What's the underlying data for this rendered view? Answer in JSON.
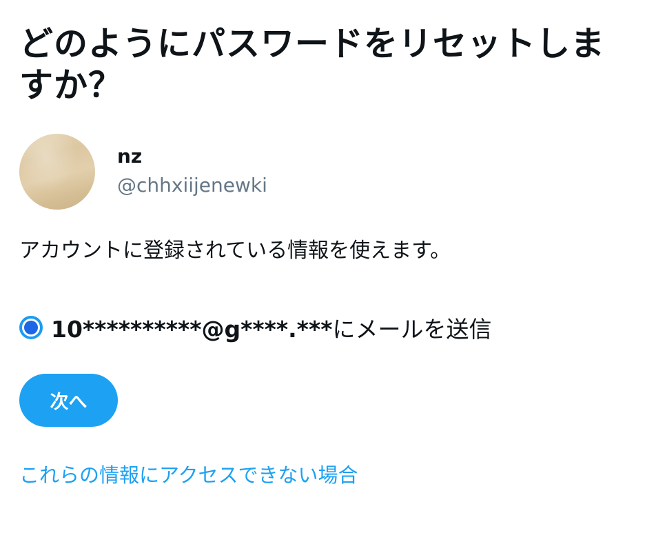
{
  "page": {
    "title": "どのようにパスワードをリセットしますか？"
  },
  "account": {
    "name": "nz",
    "handle": "@chhxiijenewki"
  },
  "description": "アカウントに登録されている情報を使えます。",
  "options": [
    {
      "masked_email": "10**********@g****.***",
      "action_text": "にメールを送信",
      "selected": true
    }
  ],
  "buttons": {
    "next_label": "次へ"
  },
  "links": {
    "cannot_access": "これらの情報にアクセスできない場合"
  },
  "colors": {
    "accent": "#1da1f2",
    "radio_selected": "#1d66e6",
    "text_primary": "#0f1419",
    "text_secondary": "#657786"
  },
  "icons": {
    "radio": "radio-selected-icon"
  }
}
